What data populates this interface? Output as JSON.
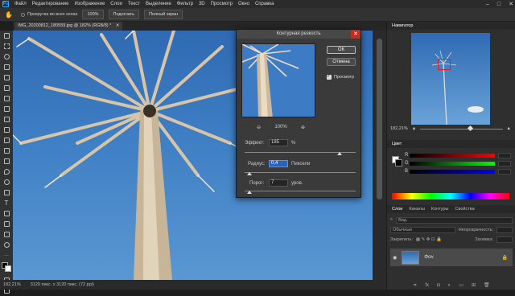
{
  "menubar": {
    "logo": "Ps",
    "items": [
      "Файл",
      "Редактирование",
      "Изображение",
      "Слои",
      "Текст",
      "Выделение",
      "Фильтр",
      "3D",
      "Просмотр",
      "Окно",
      "Справка"
    ]
  },
  "options": {
    "scroll_all": "Прокрутка во всех окнах",
    "zoom": "100%",
    "fit": "Подогнать",
    "fullscreen": "Полный экран"
  },
  "document": {
    "tab": "IMG_20200812_180559.jpg @ 182% (RGB/8) *",
    "status_zoom": "182,21%",
    "status_info": "3120 пикс. х 3120 пикс. (72 ppi)"
  },
  "dialog": {
    "title": "Контурная резкость",
    "ok": "ОК",
    "cancel": "Отмена",
    "preview_label": "Просмотр",
    "zoom_out": "⊖",
    "zoom_value": "100%",
    "zoom_in": "⊕",
    "amount_label": "Эффект:",
    "amount_value": "185",
    "amount_unit": "%",
    "radius_label": "Радиус:",
    "radius_value": "0,4",
    "radius_unit": "Пиксели",
    "threshold_label": "Порог:",
    "threshold_value": "7",
    "threshold_unit": "уров."
  },
  "navigator": {
    "title": "Навигатор",
    "zoom": "182,21%"
  },
  "color": {
    "tabs": [
      "Цвет"
    ],
    "rows": [
      "R",
      "G",
      "B"
    ],
    "values": [
      "",
      "",
      ""
    ]
  },
  "layers": {
    "tabs": [
      "Слои",
      "Каналы",
      "Контуры",
      "Свойства"
    ],
    "search_placeholder": "Вид",
    "blend_mode": "Обычные",
    "opacity_label": "Непрозрачность:",
    "lock_label": "Закрепить:",
    "fill_label": "Заливка:",
    "layer_name": "Фон"
  }
}
